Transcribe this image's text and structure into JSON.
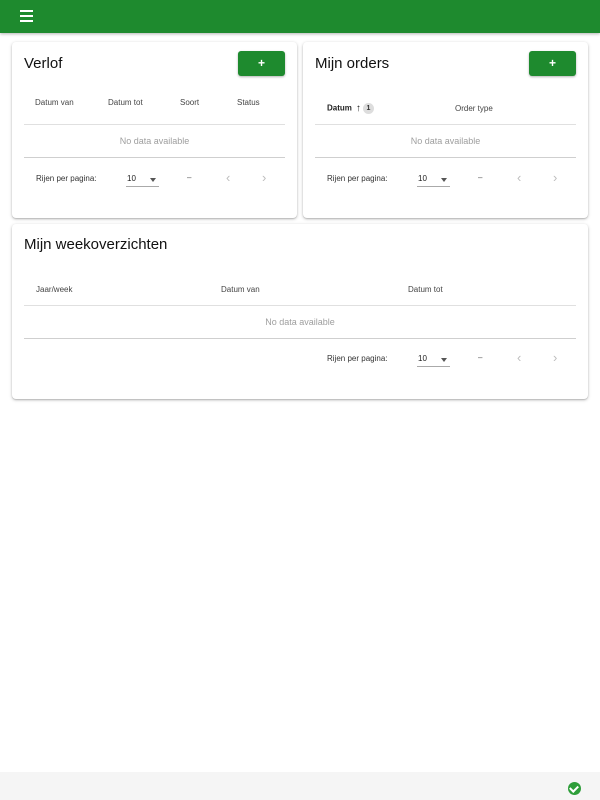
{
  "colors": {
    "primary": "#1e8a2e",
    "status_ok": "#2e9e3a"
  },
  "verlof": {
    "title": "Verlof",
    "add_label": "+",
    "columns": [
      "Datum van",
      "Datum tot",
      "Soort",
      "Status"
    ],
    "empty_text": "No data available",
    "rows_per_page_label": "Rijen per pagina:",
    "rows_per_page_value": "10",
    "range_text": "–"
  },
  "orders": {
    "title": "Mijn orders",
    "add_label": "+",
    "columns": [
      "Datum",
      "Order type"
    ],
    "sort_badge": "1",
    "empty_text": "No data available",
    "rows_per_page_label": "Rijen per pagina:",
    "rows_per_page_value": "10",
    "range_text": "–"
  },
  "week": {
    "title": "Mijn weekoverzichten",
    "columns": [
      "Jaar/week",
      "Datum van",
      "Datum tot"
    ],
    "empty_text": "No data available",
    "rows_per_page_label": "Rijen per pagina:",
    "rows_per_page_value": "10",
    "range_text": "–"
  },
  "icons": {
    "menu": "menu-icon",
    "prev": "chevron-left-icon",
    "next": "chevron-right-icon",
    "sort": "arrow-up-icon",
    "status": "check-circle-icon"
  }
}
